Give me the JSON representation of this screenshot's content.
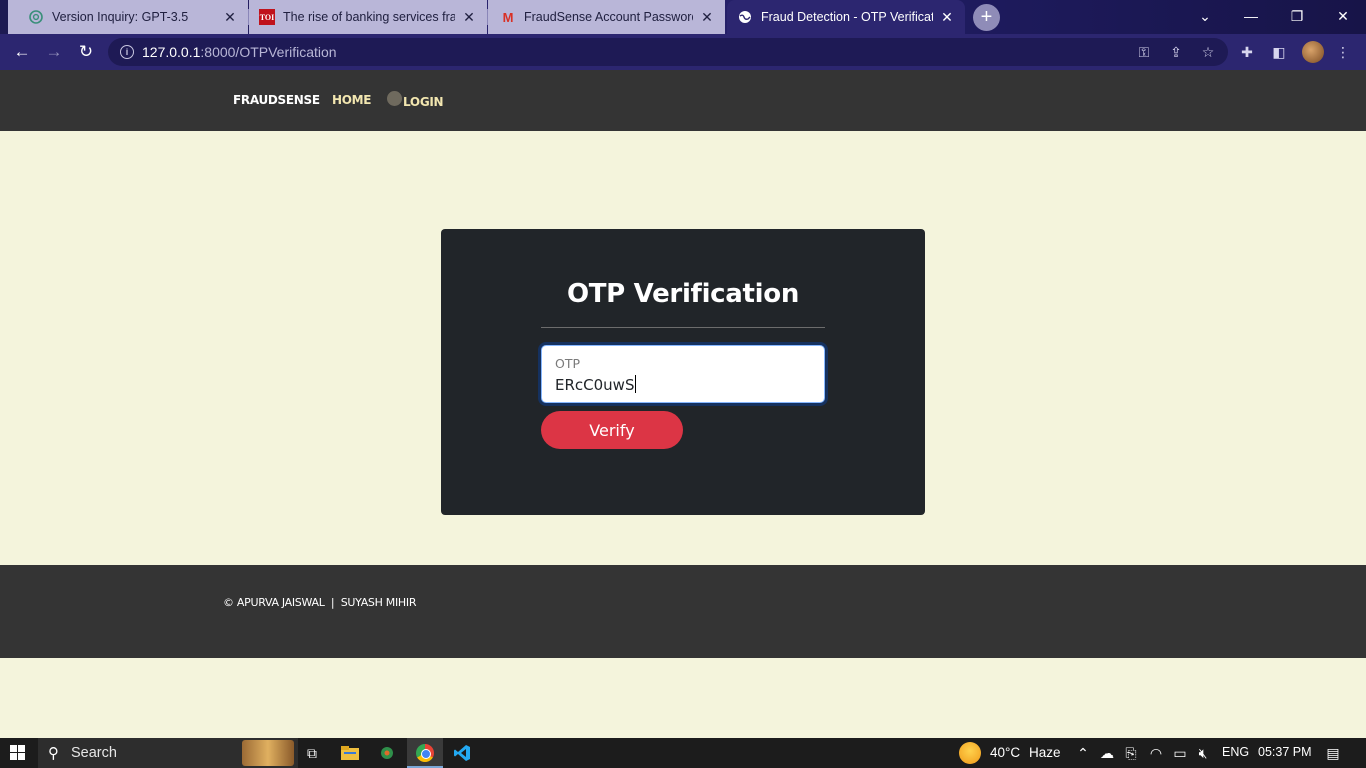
{
  "browser": {
    "tabs": [
      {
        "title": "Version Inquiry: GPT-3.5",
        "favicon": "openai-icon",
        "active": false
      },
      {
        "title": "The rise of banking services frauds",
        "favicon": "toi-icon",
        "favicon_text": "TOI",
        "active": false
      },
      {
        "title": "FraudSense Account Password Reset",
        "favicon": "gmail-icon",
        "favicon_text": "M",
        "active": false
      },
      {
        "title": "Fraud Detection - OTP Verification",
        "favicon": "globe-icon",
        "active": true
      }
    ],
    "url_host": "127.0.0.1",
    "url_path": ":8000/OTPVerification"
  },
  "nav": {
    "brand": "FRAUDSENSE",
    "home": "HOME",
    "login": "LOGIN"
  },
  "form": {
    "title": "OTP Verification",
    "otp_label": "OTP",
    "otp_value": "ERcC0uwS",
    "verify_label": "Verify"
  },
  "footer": {
    "credits": "© APURVA JAISWAL  |  SUYASH MIHIR"
  },
  "taskbar": {
    "search_label": "Search",
    "weather_temp": "40°C",
    "weather_desc": "Haze",
    "language": "ENG",
    "time": "05:37 PM"
  },
  "colors": {
    "page_bg": "#f4f4dc",
    "nav_bg": "#343434",
    "card_bg": "#212529",
    "verify_button": "#dc3545",
    "nav_link": "#f2e6b0"
  }
}
